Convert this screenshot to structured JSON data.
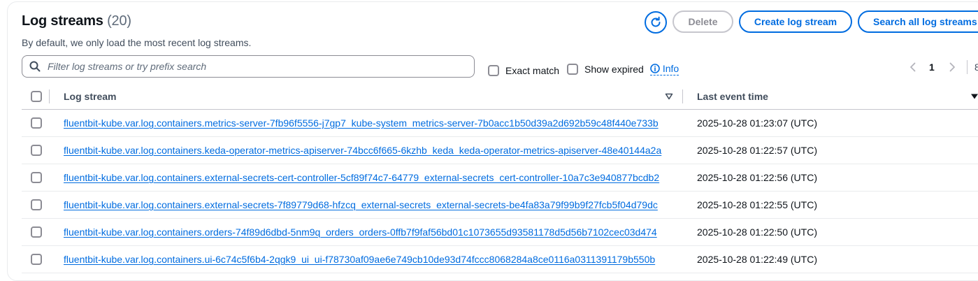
{
  "header": {
    "title": "Log streams",
    "count": "(20)",
    "subtitle": "By default, we only load the most recent log streams."
  },
  "toolbar": {
    "refresh_icon": "refresh-icon",
    "delete_label": "Delete",
    "create_label": "Create log stream",
    "search_all_label": "Search all log streams"
  },
  "filter": {
    "placeholder": "Filter log streams or try prefix search",
    "exact_match_label": "Exact match",
    "exact_match_checked": false,
    "show_expired_label": "Show expired",
    "show_expired_checked": false,
    "info_label": "Info"
  },
  "pagination": {
    "current_page": "1",
    "next_page_partial": "8"
  },
  "table": {
    "columns": [
      "Log stream",
      "Last event time"
    ],
    "rows": [
      {
        "stream": "fluentbit-kube.var.log.containers.metrics-server-7fb96f5556-j7gp7_kube-system_metrics-server-7b0acc1b50d39a2d692b59c48f440e733b",
        "time": "2025-10-28 01:23:07 (UTC)"
      },
      {
        "stream": "fluentbit-kube.var.log.containers.keda-operator-metrics-apiserver-74bcc6f665-6kzhb_keda_keda-operator-metrics-apiserver-48e40144a2a",
        "time": "2025-10-28 01:22:57 (UTC)"
      },
      {
        "stream": "fluentbit-kube.var.log.containers.external-secrets-cert-controller-5cf89f74c7-64779_external-secrets_cert-controller-10a7c3e940877bcdb2",
        "time": "2025-10-28 01:22:56 (UTC)"
      },
      {
        "stream": "fluentbit-kube.var.log.containers.external-secrets-7f89779d68-hfzcq_external-secrets_external-secrets-be4fa83a79f99b9f27fcb5f04d79dc",
        "time": "2025-10-28 01:22:55 (UTC)"
      },
      {
        "stream": "fluentbit-kube.var.log.containers.orders-74f89d6dbd-5nm9q_orders_orders-0ffb7f9faf56bd01c1073655d93581178d5d56b7102cec03d474",
        "time": "2025-10-28 01:22:50 (UTC)"
      },
      {
        "stream": "fluentbit-kube.var.log.containers.ui-6c74c5f6b4-2qgk9_ui_ui-f78730af09ae6e749cb10de93d74fccc8068284a8ce0116a0311391179b550b",
        "time": "2025-10-28 01:22:49 (UTC)"
      }
    ]
  },
  "colors": {
    "accent": "#006ce0",
    "disabled": "#8c8c94",
    "text": "#0f141a"
  }
}
